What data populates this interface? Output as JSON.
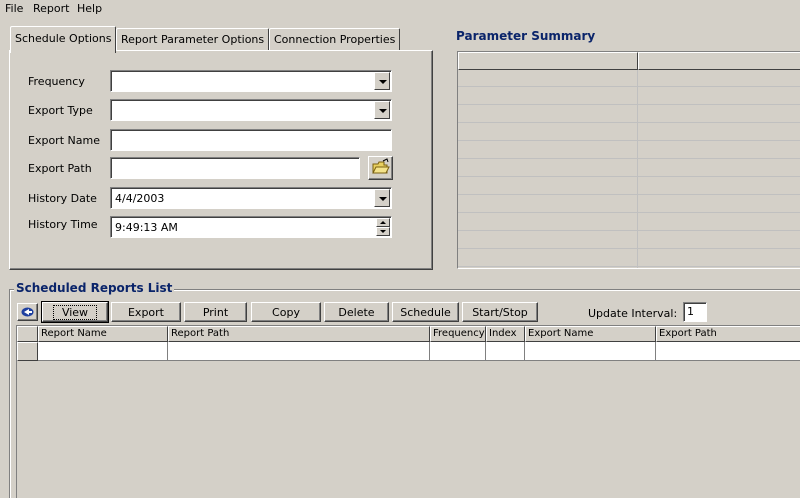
{
  "menu": [
    "File",
    "Report",
    "Help"
  ],
  "tabs": [
    "Schedule Options",
    "Report Parameter Options",
    "Connection Properties"
  ],
  "schedule_options": {
    "frequency_label": "Frequency",
    "export_type_label": "Export Type",
    "export_name_label": "Export Name",
    "export_path_label": "Export Path",
    "history_date_label": "History Date",
    "history_date_value": "4/4/2003",
    "history_time_label": "History Time",
    "history_time_value": "9:49:13 AM"
  },
  "parameter_summary": {
    "title": "Parameter Summary"
  },
  "scheduled_reports": {
    "title": "Scheduled Reports List",
    "buttons": [
      "View",
      "Export",
      "Print",
      "Copy",
      "Delete",
      "Schedule",
      "Start/Stop"
    ],
    "update_interval_label": "Update Interval:",
    "update_interval_value": "1",
    "columns": [
      "Report Name",
      "Report Path",
      "Frequency",
      "Index",
      "Export Name",
      "Export Path"
    ]
  },
  "colors": {
    "section_title": "#0a246a",
    "face": "#d4d0c8"
  }
}
